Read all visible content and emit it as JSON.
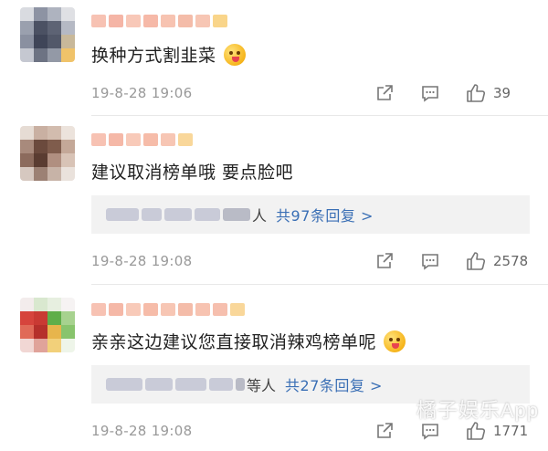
{
  "comments": [
    {
      "text": "换种方式割韭菜",
      "time": "19-8-28 19:06",
      "likes": "39",
      "has_replies": false,
      "emoji": "yummy-face-emoji"
    },
    {
      "text": "建议取消榜单哦 要点脸吧",
      "time": "19-8-28 19:08",
      "likes": "2578",
      "has_replies": true,
      "reply_suffix": "人",
      "reply_link": "共97条回复 >"
    },
    {
      "text": "亲亲这边建议您直接取消辣鸡榜单呢",
      "time": "19-8-28 19:08",
      "likes": "1771",
      "has_replies": true,
      "reply_suffix": "等人",
      "reply_link": "共27条回复 >",
      "emoji": "yummy-face-emoji"
    }
  ],
  "watermark": "橘子娱乐App",
  "colors": {
    "link": "#3a6fb5",
    "reply_bg": "#f2f2f2",
    "meta": "#999999"
  }
}
